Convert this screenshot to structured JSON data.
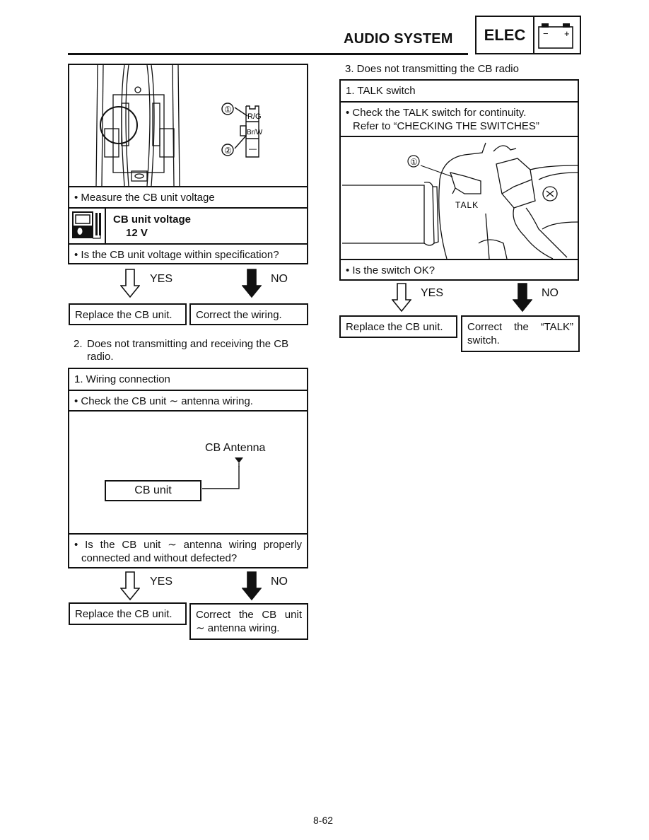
{
  "header": {
    "section_title": "AUDIO SYSTEM",
    "chapter_badge": "ELEC",
    "chapter_icon": "battery-icon",
    "battery_minus": "−",
    "battery_plus": "+"
  },
  "left_column": {
    "block1": {
      "figure": {
        "callout_1": "①",
        "callout_2": "②",
        "connector_labels": [
          "R/G",
          "Br/W",
          "—"
        ]
      },
      "step": "• Measure the CB unit voltage",
      "spec_icon": "multimeter-icon",
      "spec_title": "CB unit voltage",
      "spec_value": "12 V",
      "question": "• Is the CB unit voltage within specification?",
      "yes_label": "YES",
      "no_label": "NO",
      "yes_result": "Replace the CB unit.",
      "no_result": "Correct the wiring."
    },
    "section2": {
      "heading_num": "2.",
      "heading_text": "Does not transmitting and receiving the CB radio.",
      "check_title": "1. Wiring connection",
      "step": "• Check the CB unit ∼ antenna wiring.",
      "diagram": {
        "antenna_label": "CB Antenna",
        "unit_label": "CB unit"
      },
      "question_line1": "• Is the CB unit ∼ antenna wiring properly",
      "question_line2": "connected and without defected?",
      "yes_label": "YES",
      "no_label": "NO",
      "yes_result": "Replace the CB unit.",
      "no_result_line1": "Correct the CB unit",
      "no_result_line2": "∼ antenna wiring."
    }
  },
  "right_column": {
    "section3": {
      "heading": "3. Does not transmitting the CB radio",
      "check_title": "1. TALK switch",
      "step_line1": "• Check the TALK switch for continuity.",
      "step_line2": "Refer to “CHECKING THE SWITCHES”",
      "figure": {
        "callout_1": "①",
        "switch_label": "TALK"
      },
      "question": "• Is the switch OK?",
      "yes_label": "YES",
      "no_label": "NO",
      "yes_result": "Replace the CB unit.",
      "no_result_line1": "Correct the “TALK”",
      "no_result_line2": "switch."
    }
  },
  "footer": {
    "page_number": "8-62"
  }
}
